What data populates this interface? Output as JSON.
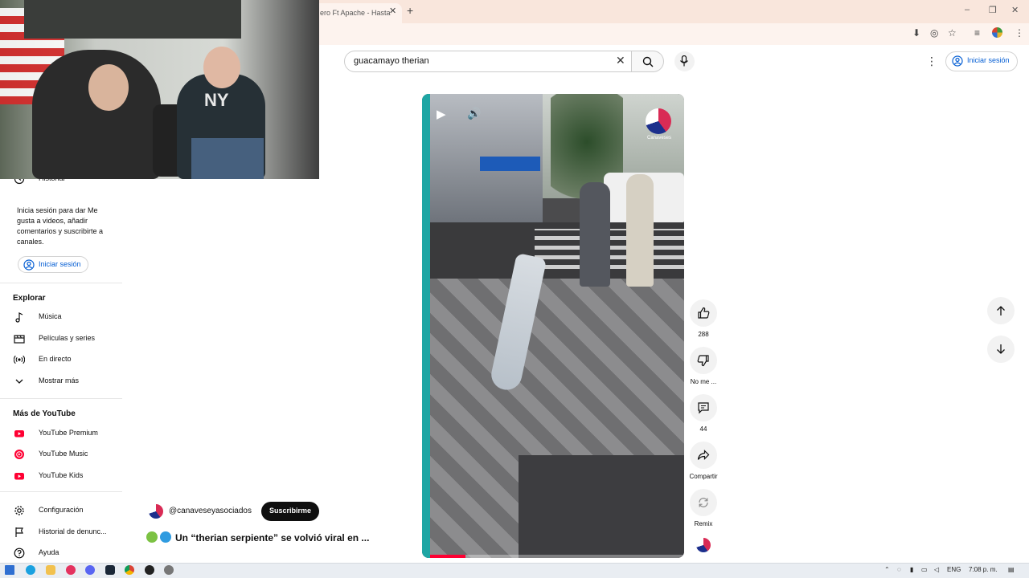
{
  "browser": {
    "tab_title": "ero Ft Apache - Hasta",
    "tab_close": "✕",
    "new_tab": "+",
    "window_controls": [
      "–",
      "❐",
      "✕"
    ]
  },
  "search": {
    "value": "guacamayo therian",
    "clear": "✕"
  },
  "header": {
    "more": "⋮",
    "signin_label": "Iniciar sesión"
  },
  "sidebar": {
    "history_label": "Historial",
    "signin_message": "Inicia sesión para dar Me gusta a videos, añadir comentarios y suscribirte a canales.",
    "signin_label": "Iniciar sesión",
    "explore_heading": "Explorar",
    "explore_items": [
      {
        "label": "Música",
        "icon": "music-note-icon"
      },
      {
        "label": "Películas y series",
        "icon": "clapperboard-icon"
      },
      {
        "label": "En directo",
        "icon": "live-icon"
      },
      {
        "label": "Mostrar más",
        "icon": "chevron-down-icon"
      }
    ],
    "more_heading": "Más de YouTube",
    "more_items": [
      {
        "label": "YouTube Premium",
        "icon": "youtube-premium-icon"
      },
      {
        "label": "YouTube Music",
        "icon": "youtube-music-icon"
      },
      {
        "label": "YouTube Kids",
        "icon": "youtube-kids-icon"
      }
    ],
    "bottom_items": [
      {
        "label": "Configuración",
        "icon": "gear-icon"
      },
      {
        "label": "Historial de denunc...",
        "icon": "flag-icon"
      },
      {
        "label": "Ayuda",
        "icon": "help-icon"
      }
    ]
  },
  "video": {
    "play_icon": "▶",
    "volume_icon": "🔊",
    "watermark": "Canaveses",
    "progress": 0.14
  },
  "actions": {
    "like_count": "288",
    "dislike_label": "No me ...",
    "comments_count": "44",
    "share_label": "Compartir",
    "remix_label": "Remix"
  },
  "channel": {
    "handle": "@canaveseyasociados",
    "subscribe_label": "Suscribirme",
    "title": "Un “therian serpiente” se volvió viral en ..."
  },
  "taskbar": {
    "lang": "ENG",
    "time": "7:08 p. m."
  },
  "colors": {
    "accent": "#065fd4",
    "progress": "#ff0033",
    "video_border": "#1ea6a4"
  }
}
